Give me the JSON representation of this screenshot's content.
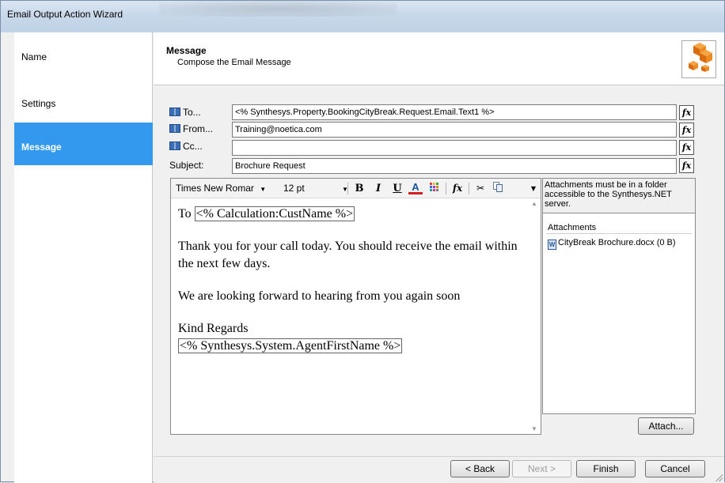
{
  "window": {
    "title": "Email Output Action Wizard"
  },
  "sidebar": {
    "items": [
      {
        "label": "Name"
      },
      {
        "label": "Settings"
      },
      {
        "label": "Message",
        "active": true
      }
    ]
  },
  "header": {
    "title": "Message",
    "subtitle": "Compose the Email Message"
  },
  "fields": {
    "to": {
      "label": "To...",
      "value": "<% Synthesys.Property.BookingCityBreak.Request.Email.Text1 %>"
    },
    "from": {
      "label": "From...",
      "value": "Training@noetica.com"
    },
    "cc": {
      "label": "Cc...",
      "value": ""
    },
    "subject": {
      "label": "Subject:",
      "value": "Brochure Request"
    },
    "fx_label": "fx"
  },
  "toolbar": {
    "font": "Times New Romar",
    "size": "12 pt",
    "bold": "B",
    "italic": "I",
    "underline": "U",
    "font_color": "A",
    "fx": "fx"
  },
  "editor": {
    "line1_prefix": "To ",
    "line1_tag": "<% Calculation:CustName %>",
    "para2": "Thank you for your call today.  You should receive the email within the next few days.",
    "para3": "We are looking forward to hearing from you again soon",
    "sign_off": "Kind Regards",
    "agent_tag": "<% Synthesys.System.AgentFirstName %>"
  },
  "attachments": {
    "note": "Attachments must be in a folder accessible to the Synthesys.NET server.",
    "header": "Attachments",
    "items": [
      {
        "name": "CityBreak Brochure.docx (0 B)"
      }
    ],
    "attach_button": "Attach..."
  },
  "footer": {
    "back": "< Back",
    "next": "Next >",
    "finish": "Finish",
    "cancel": "Cancel"
  },
  "icons": {
    "address_book": "address-book-icon",
    "word_doc": "word-doc-icon",
    "color_grid": "color-grid-icon",
    "cut": "scissors-icon",
    "copy": "copy-icon",
    "logo": "cubes-logo-icon"
  },
  "colors": {
    "accent": "#3399ee",
    "title_bar": "#c8d8ea",
    "logo": "#e8821a"
  }
}
